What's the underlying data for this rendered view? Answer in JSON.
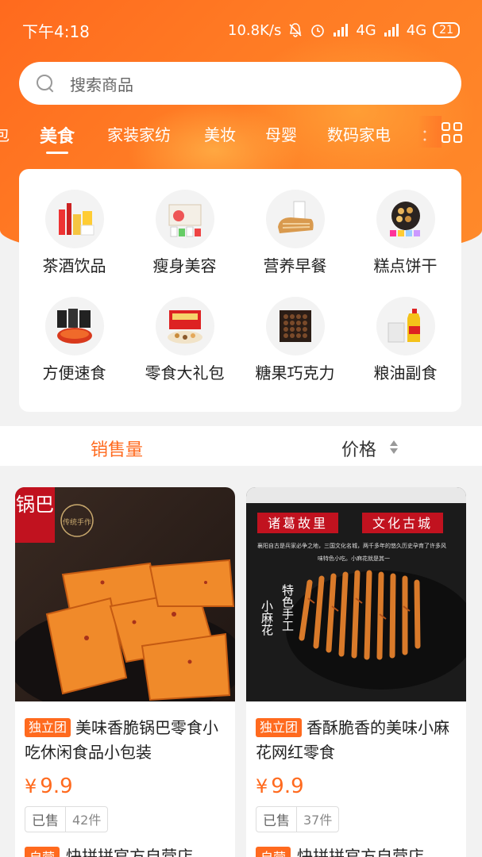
{
  "status_bar": {
    "time": "下午4:18",
    "speed": "10.8K/s",
    "network1": "4G",
    "network2": "4G",
    "battery": "21"
  },
  "search": {
    "placeholder": "搜索商品"
  },
  "category_tabs": [
    {
      "label": "包"
    },
    {
      "label": "美食",
      "active": true
    },
    {
      "label": "家装家纺"
    },
    {
      "label": "美妆"
    },
    {
      "label": "母婴"
    },
    {
      "label": "数码家电"
    },
    {
      "label": "："
    }
  ],
  "categories": [
    {
      "label": "茶酒饮品",
      "icon": "tea-wine-icon"
    },
    {
      "label": "瘦身美容",
      "icon": "slimming-icon"
    },
    {
      "label": "营养早餐",
      "icon": "bread-icon"
    },
    {
      "label": "糕点饼干",
      "icon": "cookies-icon"
    },
    {
      "label": "方便速食",
      "icon": "instant-noodles-icon"
    },
    {
      "label": "零食大礼包",
      "icon": "snack-gift-icon"
    },
    {
      "label": "糖果巧克力",
      "icon": "chocolate-icon"
    },
    {
      "label": "粮油副食",
      "icon": "oil-grain-icon"
    }
  ],
  "sort": {
    "sales": "销售量",
    "price": "价格"
  },
  "products": [
    {
      "tag": "独立团",
      "title": "美味香脆锅巴零食小吃休闲食品小包装",
      "price": "9.9",
      "currency": "¥",
      "sold_label": "已售",
      "sold_count": "42件",
      "shop_tag": "自营",
      "shop": "快拼拼官方自营店",
      "image_text": {
        "banner": "锅巴",
        "side": "传统手作"
      }
    },
    {
      "tag": "独立团",
      "title": "香酥脆香的美味小麻花网红零食",
      "price": "9.9",
      "currency": "¥",
      "sold_label": "已售",
      "sold_count": "37件",
      "shop_tag": "自营",
      "shop": "快拼拼官方自营店",
      "image_text": {
        "left": "诸葛故里",
        "right": "文化古城",
        "desc1": "襄阳自古是兵家必争之地，三国文化名城，两千多年的悠久历史孕育了许多风",
        "desc2": "味特色小吃。小麻花就是其一",
        "vertical1": "特色手工",
        "vertical2": "小麻花"
      }
    }
  ],
  "colors": {
    "accent": "#ff6a1e",
    "background": "#f2f2f2"
  }
}
